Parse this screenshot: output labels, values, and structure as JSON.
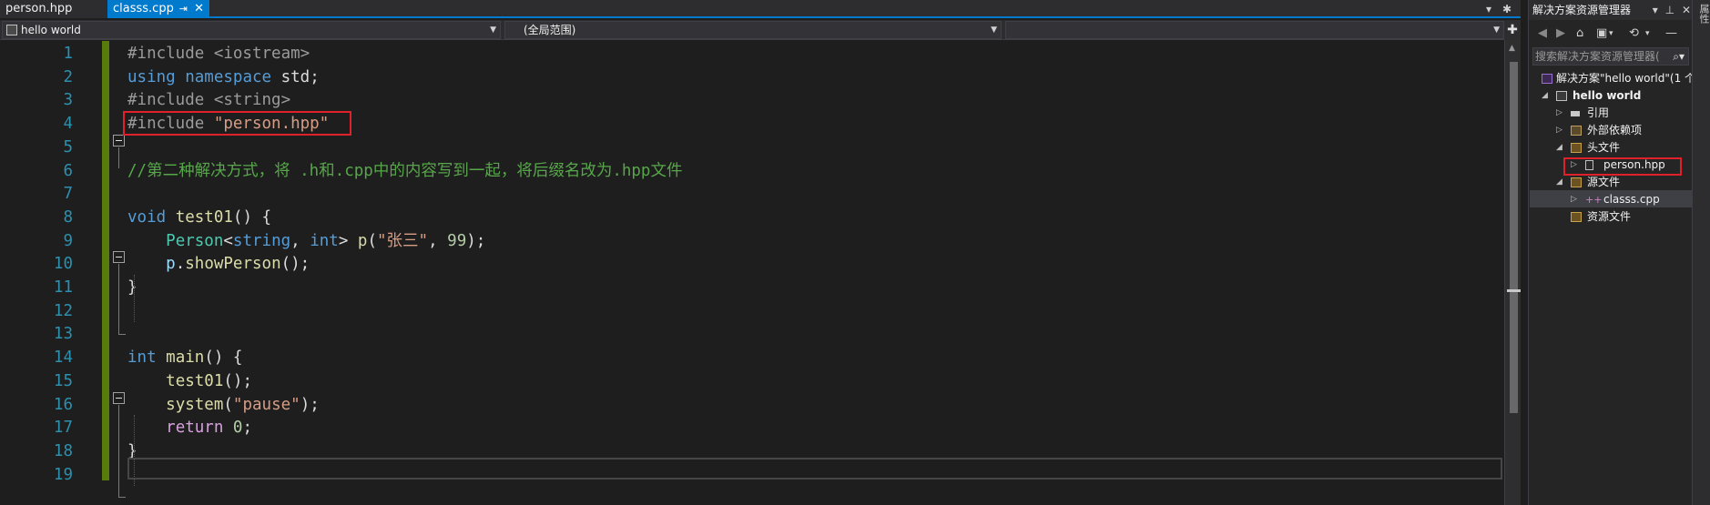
{
  "tabs": [
    {
      "label": "person.hpp",
      "active": false
    },
    {
      "label": "classs.cpp",
      "active": true
    }
  ],
  "tab_pin_glyph": "⇥",
  "tab_close_glyph": "✕",
  "navbar": {
    "project_combo": "hello world",
    "scope_combo": "(全局范围)"
  },
  "editor": {
    "line_numbers": [
      "1",
      "2",
      "3",
      "4",
      "5",
      "6",
      "7",
      "8",
      "9",
      "10",
      "11",
      "12",
      "13",
      "14",
      "15",
      "16",
      "17",
      "18",
      "19"
    ],
    "lines": [
      {
        "parts": [
          [
            "pp",
            "#include <iostream>"
          ]
        ]
      },
      {
        "parts": [
          [
            "kw",
            "using"
          ],
          [
            "plain",
            " "
          ],
          [
            "kw",
            "namespace"
          ],
          [
            "plain",
            " std;"
          ]
        ]
      },
      {
        "parts": [
          [
            "pp",
            "#include <string>"
          ]
        ]
      },
      {
        "parts": [
          [
            "pp",
            "#include "
          ],
          [
            "str",
            "\"person.hpp\""
          ]
        ]
      },
      {
        "parts": []
      },
      {
        "parts": [
          [
            "cmt",
            "//第二种解决方式，将 .h和.cpp中的内容写到一起，将后缀名改为.hpp文件"
          ]
        ]
      },
      {
        "parts": []
      },
      {
        "parts": [
          [
            "kw",
            "void"
          ],
          [
            "plain",
            " "
          ],
          [
            "fn",
            "test01"
          ],
          [
            "plain",
            "() {"
          ]
        ]
      },
      {
        "parts": [
          [
            "plain",
            "    "
          ],
          [
            "type",
            "Person"
          ],
          [
            "plain",
            "<"
          ],
          [
            "kw",
            "string"
          ],
          [
            "plain",
            ", "
          ],
          [
            "kw",
            "int"
          ],
          [
            "plain",
            "> "
          ],
          [
            "fn",
            "p"
          ],
          [
            "plain",
            "("
          ],
          [
            "str",
            "\"张三\""
          ],
          [
            "plain",
            ", "
          ],
          [
            "num",
            "99"
          ],
          [
            "plain",
            ");"
          ]
        ]
      },
      {
        "parts": [
          [
            "plain",
            "    "
          ],
          [
            "var",
            "p"
          ],
          [
            "plain",
            "."
          ],
          [
            "fn",
            "showPerson"
          ],
          [
            "plain",
            "();"
          ]
        ]
      },
      {
        "parts": [
          [
            "plain",
            "}"
          ]
        ]
      },
      {
        "parts": []
      },
      {
        "parts": []
      },
      {
        "parts": [
          [
            "kw",
            "int"
          ],
          [
            "plain",
            " "
          ],
          [
            "fn",
            "main"
          ],
          [
            "plain",
            "() {"
          ]
        ]
      },
      {
        "parts": [
          [
            "plain",
            "    "
          ],
          [
            "fn",
            "test01"
          ],
          [
            "plain",
            "();"
          ]
        ]
      },
      {
        "parts": [
          [
            "plain",
            "    "
          ],
          [
            "fn",
            "system"
          ],
          [
            "plain",
            "("
          ],
          [
            "str",
            "\"pause\""
          ],
          [
            "plain",
            ");"
          ]
        ]
      },
      {
        "parts": [
          [
            "plain",
            "    "
          ],
          [
            "ctl",
            "return"
          ],
          [
            "plain",
            " "
          ],
          [
            "num",
            "0"
          ],
          [
            "plain",
            ";"
          ]
        ]
      },
      {
        "parts": [
          [
            "plain",
            "}"
          ]
        ]
      },
      {
        "parts": []
      }
    ]
  },
  "solution_explorer": {
    "title": "解决方案资源管理器",
    "search_placeholder": "搜索解决方案资源管理器(",
    "tree": [
      {
        "label": "解决方案\"hello world\"(1 个",
        "bold": false
      },
      {
        "label": "hello world",
        "bold": true
      },
      {
        "label": "引用",
        "bold": false
      },
      {
        "label": "外部依赖项",
        "bold": false
      },
      {
        "label": "头文件",
        "bold": false
      },
      {
        "label": "person.hpp",
        "bold": false
      },
      {
        "label": "源文件",
        "bold": false
      },
      {
        "label": "classs.cpp",
        "bold": false
      },
      {
        "label": "资源文件",
        "bold": false
      }
    ]
  },
  "right_edge_label": "属性"
}
